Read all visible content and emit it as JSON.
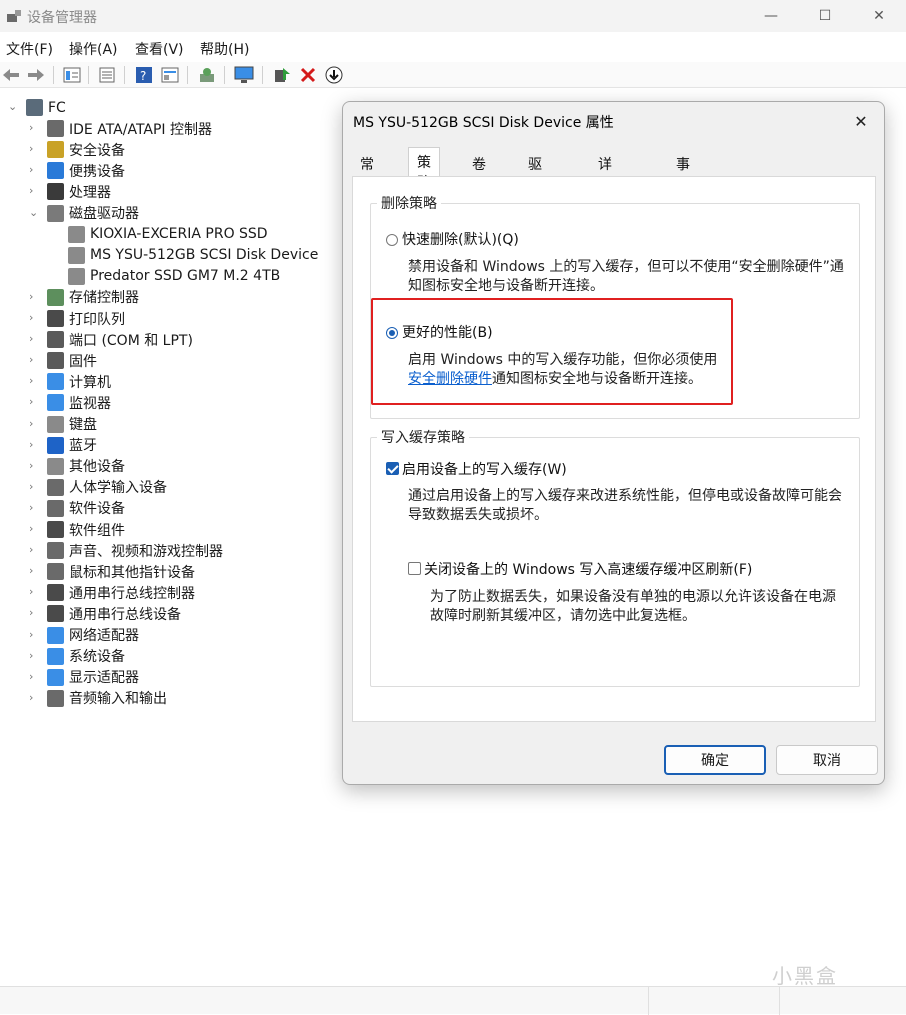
{
  "window": {
    "title": "设备管理器",
    "minimize": "—",
    "maximize": "☐",
    "close": "✕"
  },
  "menu": [
    "文件(F)",
    "操作(A)",
    "查看(V)",
    "帮助(H)"
  ],
  "tree": {
    "root": "FC",
    "items": [
      {
        "label": "IDE ATA/ATAPI 控制器",
        "icon": "ide-controller-icon",
        "color": "#6a6a6a"
      },
      {
        "label": "安全设备",
        "icon": "security-device-icon",
        "color": "#c9a227"
      },
      {
        "label": "便携设备",
        "icon": "portable-device-icon",
        "color": "#2a7ad8"
      },
      {
        "label": "处理器",
        "icon": "processor-icon",
        "color": "#3a3a3a"
      },
      {
        "label": "磁盘驱动器",
        "icon": "disk-drive-icon",
        "color": "#7a7a7a"
      },
      {
        "label": "存储控制器",
        "icon": "storage-controller-icon",
        "color": "#5d8f5d"
      },
      {
        "label": "打印队列",
        "icon": "printer-icon",
        "color": "#4a4a4a"
      },
      {
        "label": "端口 (COM 和 LPT)",
        "icon": "port-icon",
        "color": "#5a5a5a"
      },
      {
        "label": "固件",
        "icon": "firmware-icon",
        "color": "#5a5a5a"
      },
      {
        "label": "计算机",
        "icon": "computer-icon",
        "color": "#3a8ee6"
      },
      {
        "label": "监视器",
        "icon": "monitor-icon",
        "color": "#3a8ee6"
      },
      {
        "label": "键盘",
        "icon": "keyboard-icon",
        "color": "#8a8a8a"
      },
      {
        "label": "蓝牙",
        "icon": "bluetooth-icon",
        "color": "#1e63c7"
      },
      {
        "label": "其他设备",
        "icon": "other-device-icon",
        "color": "#8a8a8a"
      },
      {
        "label": "人体学输入设备",
        "icon": "hid-icon",
        "color": "#6a6a6a"
      },
      {
        "label": "软件设备",
        "icon": "software-device-icon",
        "color": "#6a6a6a"
      },
      {
        "label": "软件组件",
        "icon": "software-component-icon",
        "color": "#4a4a4a"
      },
      {
        "label": "声音、视频和游戏控制器",
        "icon": "sound-icon",
        "color": "#6a6a6a"
      },
      {
        "label": "鼠标和其他指针设备",
        "icon": "mouse-icon",
        "color": "#6a6a6a"
      },
      {
        "label": "通用串行总线控制器",
        "icon": "usb-controller-icon",
        "color": "#4a4a4a"
      },
      {
        "label": "通用串行总线设备",
        "icon": "usb-device-icon",
        "color": "#4a4a4a"
      },
      {
        "label": "网络适配器",
        "icon": "network-adapter-icon",
        "color": "#3a8ee6"
      },
      {
        "label": "系统设备",
        "icon": "system-device-icon",
        "color": "#3a8ee6"
      },
      {
        "label": "显示适配器",
        "icon": "display-adapter-icon",
        "color": "#3a8ee6"
      },
      {
        "label": "音频输入和输出",
        "icon": "audio-io-icon",
        "color": "#6a6a6a"
      }
    ],
    "disks": [
      "KIOXIA-EXCERIA PRO SSD",
      "MS YSU-512GB SCSI Disk Device",
      "Predator SSD GM7 M.2 4TB"
    ]
  },
  "dialog": {
    "title": "MS YSU-512GB SCSI Disk Device 属性",
    "close": "✕",
    "tabs": [
      "常规",
      "策略",
      "卷",
      "驱动程序",
      "详细信息",
      "事件"
    ],
    "active_tab": "策略",
    "removal_group": "删除策略",
    "quick_removal": "快速删除(默认)(Q)",
    "quick_desc_1": "禁用设备和 Windows 上的写入缓存，但可以不使用“安全删除硬件”通",
    "quick_desc_2": "知图标安全地与设备断开连接。",
    "better_perf": "更好的性能(B)",
    "better_desc_1": "启用 Windows 中的写入缓存功能，但你必须使用",
    "better_link": "安全删除硬件",
    "better_desc_2": "通知图标安全地与设备断开连接。",
    "cache_group": "写入缓存策略",
    "enable_cache": "启用设备上的写入缓存(W)",
    "enable_desc_1": "通过启用设备上的写入缓存来改进系统性能，但停电或设备故障可能会",
    "enable_desc_2": "导致数据丢失或损坏。",
    "flush_off": "关闭设备上的 Windows 写入高速缓存缓冲区刷新(F)",
    "flush_desc_1": "为了防止数据丢失，如果设备没有单独的电源以允许该设备在电源",
    "flush_desc_2": "故障时刷新其缓冲区，请勿选中此复选框。",
    "ok": "确定",
    "cancel": "取消"
  },
  "watermark": "小黑盒"
}
